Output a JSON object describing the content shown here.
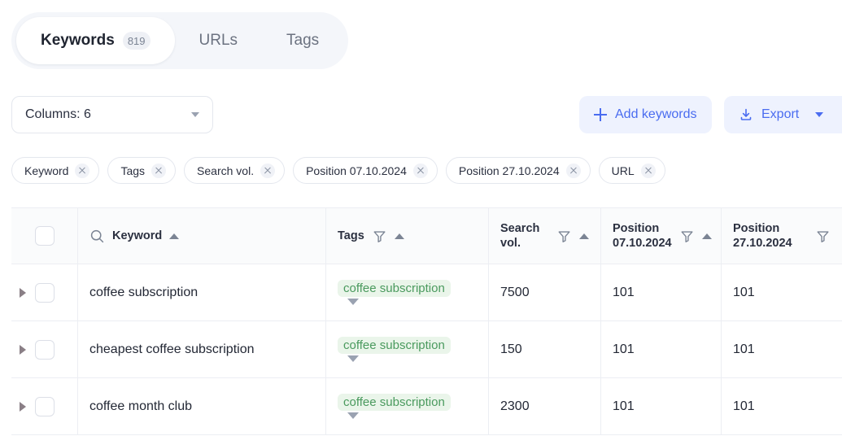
{
  "tabs": [
    {
      "label": "Keywords",
      "badge": "819",
      "active": true
    },
    {
      "label": "URLs",
      "badge": "",
      "active": false
    },
    {
      "label": "Tags",
      "badge": "",
      "active": false
    }
  ],
  "toolbar": {
    "columns_label": "Columns: 6",
    "add_keywords_label": "Add keywords",
    "export_label": "Export"
  },
  "filter_chips": [
    {
      "label": "Keyword"
    },
    {
      "label": "Tags"
    },
    {
      "label": "Search vol."
    },
    {
      "label": "Position 07.10.2024"
    },
    {
      "label": "Position 27.10.2024"
    },
    {
      "label": "URL"
    }
  ],
  "table": {
    "columns": [
      {
        "label": "Keyword",
        "search": true,
        "filter": false,
        "sort": "asc"
      },
      {
        "label": "Tags",
        "search": false,
        "filter": true,
        "sort": "asc"
      },
      {
        "label": "Search vol.",
        "search": false,
        "filter": true,
        "sort": "asc"
      },
      {
        "label": "Position 07.10.2024",
        "search": false,
        "filter": true,
        "sort": "asc"
      },
      {
        "label": "Position 27.10.2024",
        "search": false,
        "filter": true,
        "sort": "none"
      }
    ],
    "rows": [
      {
        "keyword": "coffee subscription",
        "tag": "coffee subscription",
        "volume": "7500",
        "position1": "101",
        "position2": "101"
      },
      {
        "keyword": "cheapest coffee subscription",
        "tag": "coffee subscription",
        "volume": "150",
        "position1": "101",
        "position2": "101"
      },
      {
        "keyword": "coffee month club",
        "tag": "coffee subscription",
        "volume": "2300",
        "position1": "101",
        "position2": "101"
      }
    ]
  },
  "colors": {
    "accent": "#4a6cf0",
    "tag_text": "#4a9a5e",
    "tag_bg": "#eaf5ea",
    "header_bg": "#fafbfc"
  }
}
